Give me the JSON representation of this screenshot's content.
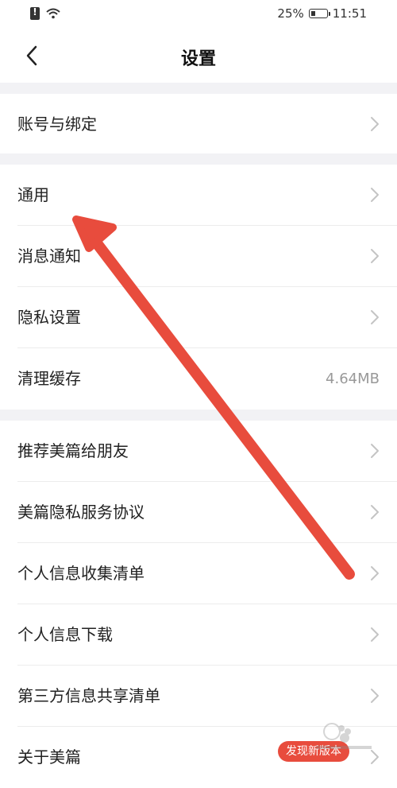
{
  "status_bar": {
    "battery": "25%",
    "time": "11:51"
  },
  "header": {
    "title": "设置",
    "back_icon": "chevron-left-icon"
  },
  "groups": [
    [
      {
        "label": "账号与绑定",
        "type": "nav"
      }
    ],
    [
      {
        "label": "通用",
        "type": "nav"
      },
      {
        "label": "消息通知",
        "type": "nav"
      },
      {
        "label": "隐私设置",
        "type": "nav"
      },
      {
        "label": "清理缓存",
        "type": "value",
        "value": "4.64MB"
      }
    ],
    [
      {
        "label": "推荐美篇给朋友",
        "type": "nav"
      },
      {
        "label": "美篇隐私服务协议",
        "type": "nav"
      },
      {
        "label": "个人信息收集清单",
        "type": "nav"
      },
      {
        "label": "个人信息下载",
        "type": "nav"
      },
      {
        "label": "第三方信息共享清单",
        "type": "nav"
      },
      {
        "label": "关于美篇",
        "type": "nav",
        "badge": "发现新版本"
      }
    ]
  ],
  "colors": {
    "annotation_arrow": "#e84c3d",
    "section_gap": "#f2f2f5",
    "badge": "#e84c3d"
  }
}
